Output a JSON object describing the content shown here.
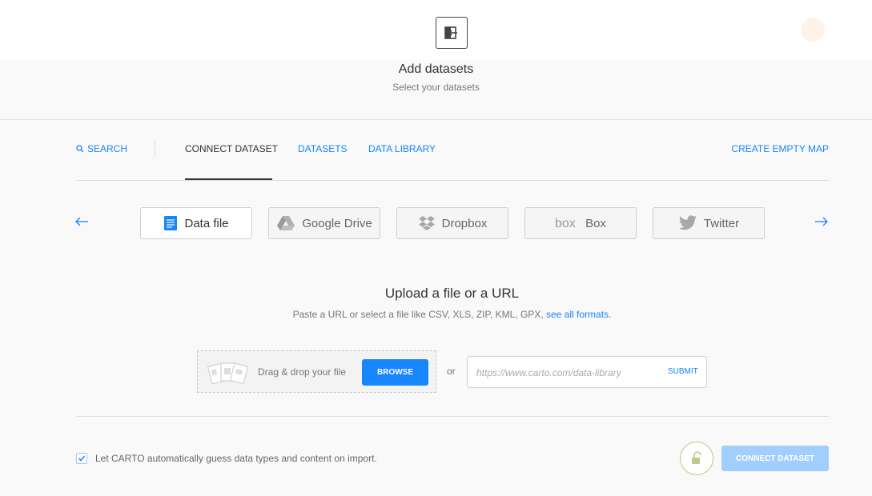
{
  "header": {
    "title": "Add datasets",
    "subtitle": "Select your datasets",
    "back_icon": "arrow-exit-icon"
  },
  "tabs": {
    "search_label": "SEARCH",
    "connect_label": "CONNECT DATASET",
    "datasets_label": "DATASETS",
    "library_label": "DATA LIBRARY",
    "create_empty_map_label": "CREATE EMPTY MAP",
    "active": "CONNECT DATASET"
  },
  "sources": {
    "items": [
      {
        "label": "Data file",
        "icon": "document-icon",
        "active": true
      },
      {
        "label": "Google Drive",
        "icon": "google-drive-icon",
        "active": false
      },
      {
        "label": "Dropbox",
        "icon": "dropbox-icon",
        "active": false
      },
      {
        "label": "Box",
        "icon": "box-logo-icon",
        "active": false
      },
      {
        "label": "Twitter",
        "icon": "twitter-icon",
        "active": false
      }
    ]
  },
  "upload": {
    "title": "Upload a file or a URL",
    "description": "Paste a URL or select a file like CSV, XLS, ZIP, KML, GPX,",
    "formats_link": "see all formats.",
    "drag_text": "Drag & drop your file",
    "browse_label": "BROWSE",
    "or_text": "or",
    "url_placeholder": "https://www.carto.com/data-library",
    "url_value": "",
    "submit_label": "SUBMIT"
  },
  "footer": {
    "guess_label": "Let CARTO automatically guess data types and content on import.",
    "guess_checked": true,
    "connect_label": "CONNECT DATASET"
  },
  "colors": {
    "accent": "#1785fb",
    "accent_disabled": "#a2cefd",
    "lock_border": "#b9cc82"
  }
}
